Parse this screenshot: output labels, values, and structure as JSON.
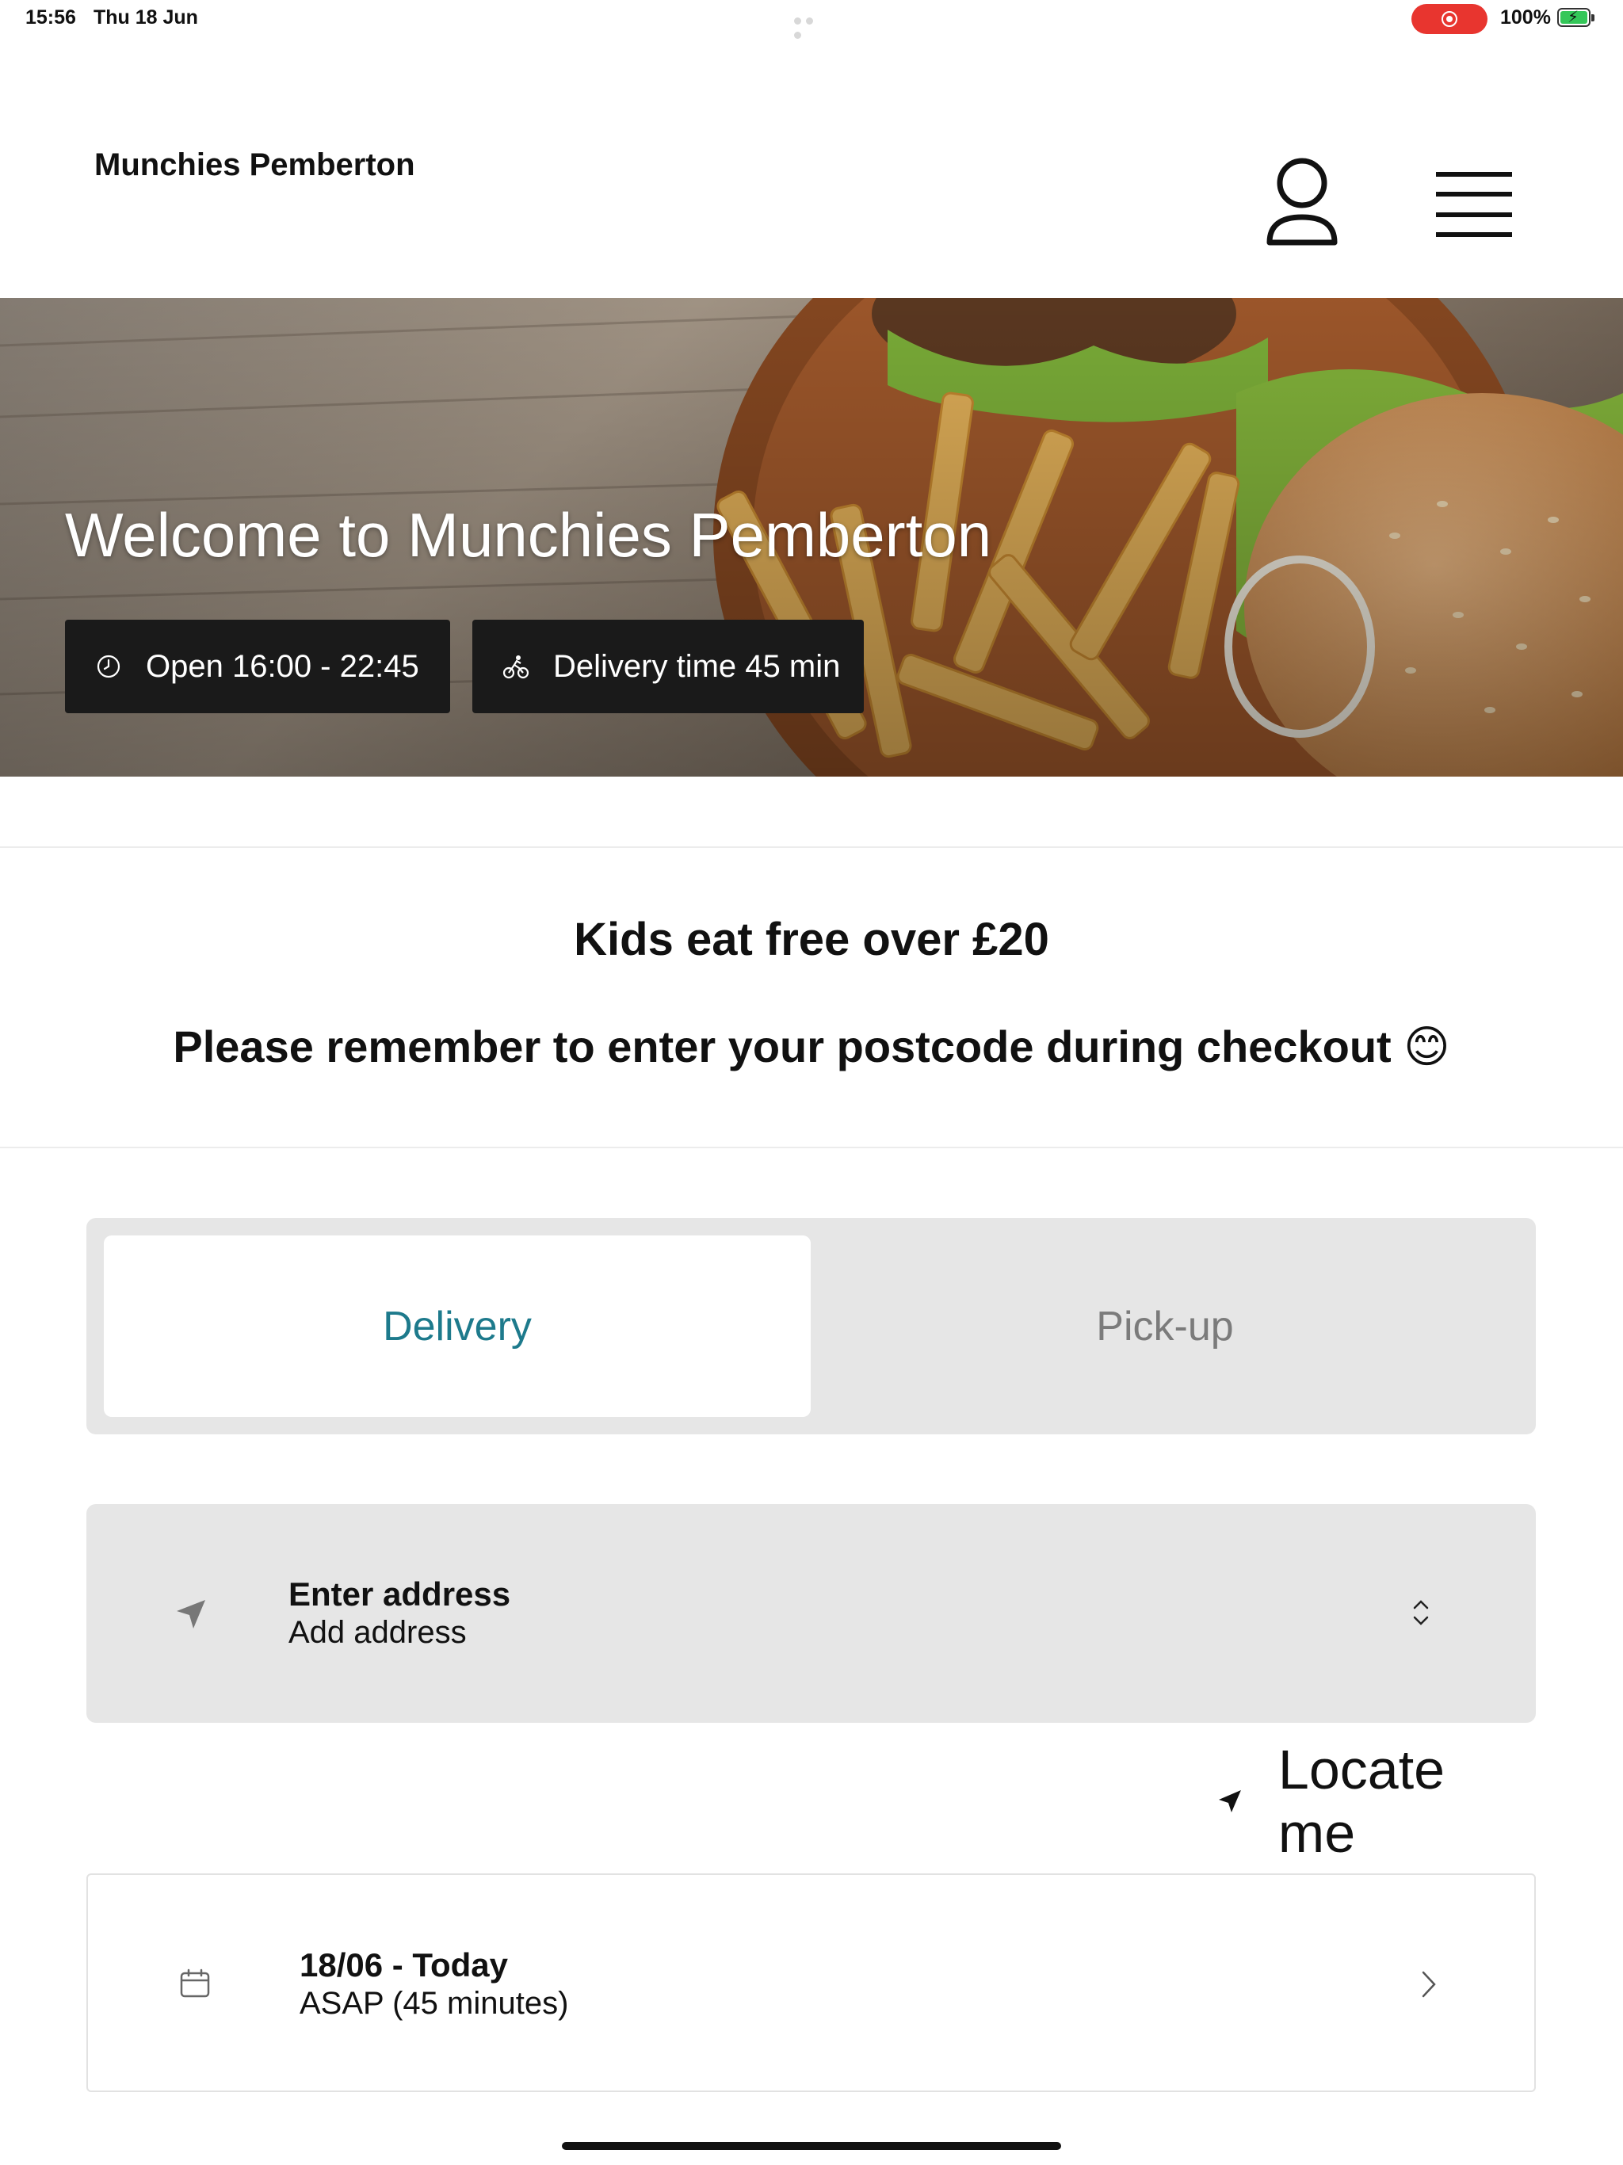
{
  "status_bar": {
    "time": "15:56",
    "date": "Thu 18 Jun",
    "battery": "100%",
    "recording_color": "#e8352f"
  },
  "header": {
    "brand": "Munchies Pemberton",
    "user_icon": "user-icon",
    "menu_icon": "menu-icon"
  },
  "hero": {
    "title": "Welcome to Munchies Pemberton",
    "hours": "Open 16:00 - 22:45",
    "delivery_time": "Delivery time 45 min",
    "background": "burger-and-fries-photo"
  },
  "announcements": {
    "line1": "Kids eat free over £20",
    "line2": "Please remember to enter your postcode during checkout 😊"
  },
  "order_mode": {
    "options": [
      "Delivery",
      "Pick-up"
    ],
    "selected": "Delivery",
    "accent_color": "#1d7a8c"
  },
  "address": {
    "title": "Enter address",
    "subtitle": "Add address"
  },
  "locate": {
    "label": "Locate me"
  },
  "time_slot": {
    "title": "18/06 - Today",
    "subtitle": "ASAP (45 minutes)"
  }
}
